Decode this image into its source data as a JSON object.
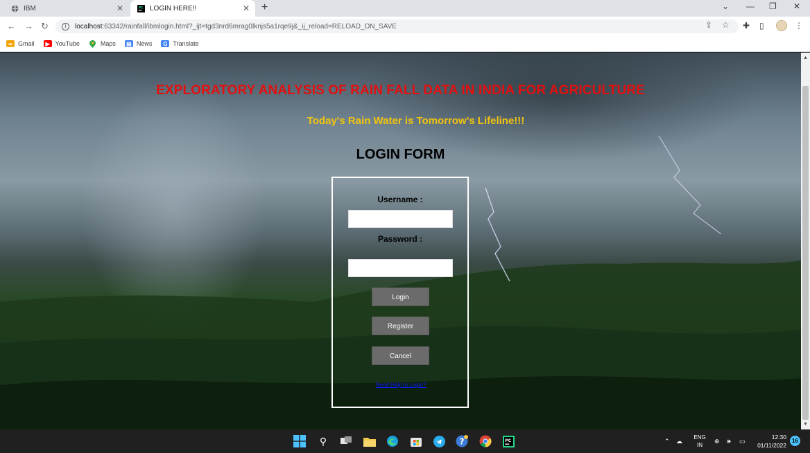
{
  "browser": {
    "tabs": [
      {
        "title": "IBM",
        "active": false
      },
      {
        "title": "LOGIN HERE!!",
        "active": true
      }
    ],
    "url_host": "localhost",
    "url_path": ":63342/rainfall/ibmlogin.html?_ijt=tgd3nrd6mrag0lknjs5a1rqe9j&_ij_reload=RELOAD_ON_SAVE",
    "bookmarks": [
      {
        "label": "Gmail",
        "icon": "gmail-icon",
        "color": "#f2a60c"
      },
      {
        "label": "YouTube",
        "icon": "youtube-icon",
        "color": "#ff0000"
      },
      {
        "label": "Maps",
        "icon": "maps-icon",
        "color": "#34a853"
      },
      {
        "label": "News",
        "icon": "news-icon",
        "color": "#4285f4"
      },
      {
        "label": "Translate",
        "icon": "translate-icon",
        "color": "#4285f4"
      }
    ]
  },
  "page": {
    "title": "EXPLORATORY ANALYSIS OF RAIN FALL DATA IN INDIA FOR AGRICULTURE",
    "subtitle": "Today's Rain Water is Tomorrow's Lifeline!!!",
    "form_heading": "LOGIN FORM",
    "title_color": "#e21010",
    "subtitle_color": "#f1c40f"
  },
  "login_form": {
    "username_label": "Username :",
    "username_value": "",
    "password_label": "Password :",
    "password_value": "",
    "login_button": "Login",
    "register_button": "Register",
    "cancel_button": "Cancel",
    "help_link": "Need Help in Login?"
  },
  "taskbar": {
    "language_line1": "ENG",
    "language_line2": "IN",
    "time": "12:30",
    "date": "01/11/2022",
    "notification_count": "16"
  }
}
